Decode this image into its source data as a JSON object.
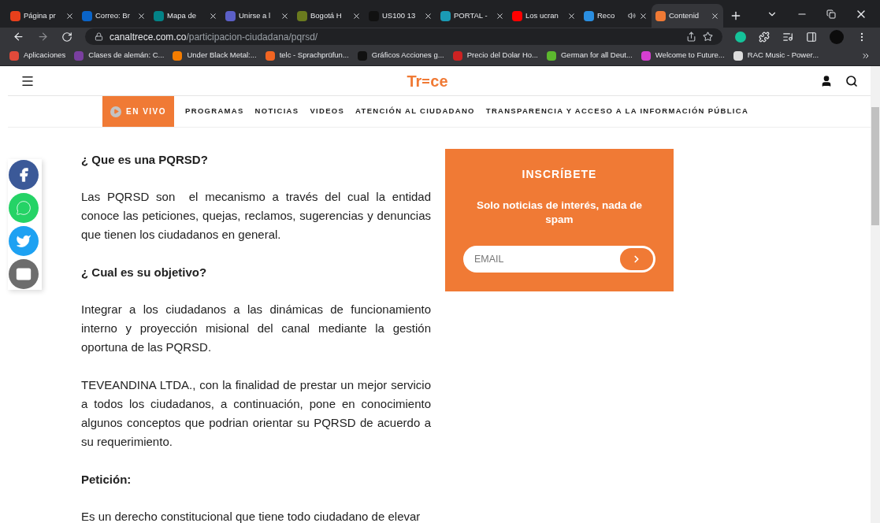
{
  "tabs": [
    {
      "title": "Página pr",
      "selected": false,
      "color": "#e8401c"
    },
    {
      "title": "Correo: Br",
      "selected": false,
      "color": "#0a64c8"
    },
    {
      "title": "Mapa de",
      "selected": false,
      "color": "#038387"
    },
    {
      "title": "Unirse a l",
      "selected": false,
      "color": "#5b5fc7"
    },
    {
      "title": "Bogotá H",
      "selected": false,
      "color": "#6a7a1e"
    },
    {
      "title": "US100 13",
      "selected": false,
      "color": "#111111"
    },
    {
      "title": "PORTAL -",
      "selected": false,
      "color": "#1a9bb5"
    },
    {
      "title": "Los ucran",
      "selected": false,
      "color": "#ff0000"
    },
    {
      "title": "Reco",
      "selected": false,
      "color": "#2a8ee0",
      "audio": true
    },
    {
      "title": "Contenid",
      "selected": true,
      "color": "#f07a35"
    }
  ],
  "address": {
    "domain": "canaltrece.com.co",
    "path": "/participacion-ciudadana/pqrsd/"
  },
  "bookmarks": [
    {
      "label": "Aplicaciones",
      "color": "#e04a3a"
    },
    {
      "label": "Clases de alemán: C...",
      "color": "#7a3fa0"
    },
    {
      "label": "Under Black Metal:...",
      "color": "#f57d00"
    },
    {
      "label": "telc - Sprachprüfun...",
      "color": "#f26522"
    },
    {
      "label": "Gráficos Acciones g...",
      "color": "#111111"
    },
    {
      "label": "Precio del Dolar Ho...",
      "color": "#cc2222"
    },
    {
      "label": "German for all Deut...",
      "color": "#5cb82e"
    },
    {
      "label": "Welcome to Future...",
      "color": "#d63fd0"
    },
    {
      "label": "RAC Music - Power...",
      "color": "#dddddd"
    }
  ],
  "logo": {
    "left": "Tr",
    "right": "ce"
  },
  "nav": {
    "live": "EN VIVO",
    "items": [
      "PROGRAMAS",
      "NOTICIAS",
      "VIDEOS",
      "ATENCIÓN AL CIUDADANO",
      "TRANSPARENCIA Y ACCESO A LA INFORMACIÓN PÚBLICA"
    ]
  },
  "social": [
    {
      "kind": "facebook",
      "color": "#3b5998"
    },
    {
      "kind": "whatsapp",
      "color": "#25d366"
    },
    {
      "kind": "twitter",
      "color": "#1da1f2"
    },
    {
      "kind": "email",
      "color": "#6d6d6d"
    }
  ],
  "article": [
    {
      "kind": "heading",
      "text": "¿ Que es una PQRSD?"
    },
    {
      "kind": "paragraph",
      "text": "Las PQRSD son  el mecanismo a través del cual la entidad conoce las peticiones, quejas, reclamos, sugerencias y denuncias que tienen los ciudadanos en general."
    },
    {
      "kind": "heading",
      "text": "¿ Cual es su objetivo?"
    },
    {
      "kind": "paragraph",
      "text": "Integrar a los ciudadanos a las dinámicas de funcionamiento interno y proyección misional del canal mediante la gestión oportuna de las PQRSD."
    },
    {
      "kind": "paragraph",
      "text": "TEVEANDINA LTDA., con la finalidad de prestar un mejor servicio a todos los ciudadanos, a continuación, pone en conocimiento algunos conceptos que podrian orientar su PQRSD de acuerdo a su requerimiento."
    },
    {
      "kind": "heading",
      "text": "Petición:"
    },
    {
      "kind": "paragraph",
      "text": "Es un derecho constitucional que tiene todo ciudadano de elevar"
    }
  ],
  "newsletter": {
    "title": "INSCRÍBETE",
    "subtitle": "Solo noticias de interés, nada de spam",
    "placeholder": "EMAIL"
  }
}
